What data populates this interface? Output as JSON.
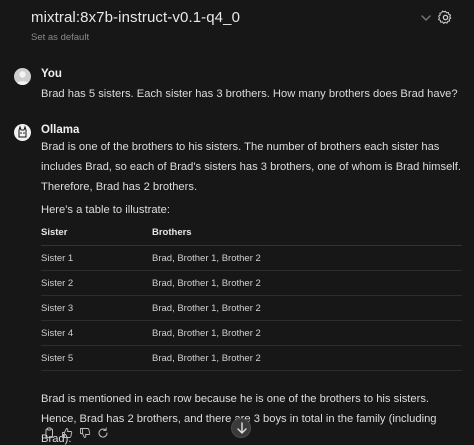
{
  "header": {
    "model_name": "mixtral:8x7b-instruct-v0.1-q4_0",
    "set_default_label": "Set as default"
  },
  "messages": [
    {
      "author": "You",
      "text": "Brad has 5 sisters. Each sister has 3 brothers. How many brothers does Brad have?"
    },
    {
      "author": "Ollama",
      "paragraph_1": "Brad is one of the brothers to his sisters. The number of brothers each sister has includes Brad, so each of Brad's sisters has 3 brothers, one of whom is Brad himself. Therefore, Brad has 2 brothers.",
      "paragraph_2": "Here's a table to illustrate:",
      "paragraph_3": "Brad is mentioned in each row because he is one of the brothers to his sisters. Hence, Brad has 2 brothers, and there are 3 boys in total in the family (including Brad)."
    }
  ],
  "table": {
    "headers": [
      "Sister",
      "Brothers"
    ],
    "rows": [
      [
        "Sister 1",
        "Brad, Brother 1, Brother 2"
      ],
      [
        "Sister 2",
        "Brad, Brother 1, Brother 2"
      ],
      [
        "Sister 3",
        "Brad, Brother 1, Brother 2"
      ],
      [
        "Sister 4",
        "Brad, Brother 1, Brother 2"
      ],
      [
        "Sister 5",
        "Brad, Brother 1, Brother 2"
      ]
    ]
  },
  "icons": {
    "header": [
      "chevron-down-icon",
      "gear-icon"
    ],
    "actions": [
      "copy-icon",
      "thumbs-up-icon",
      "thumbs-down-icon",
      "regenerate-icon"
    ],
    "scroll": "arrow-down-icon"
  },
  "colors": {
    "background": "#171717",
    "text": "#dcdcdc",
    "muted": "#8a8a8a"
  }
}
